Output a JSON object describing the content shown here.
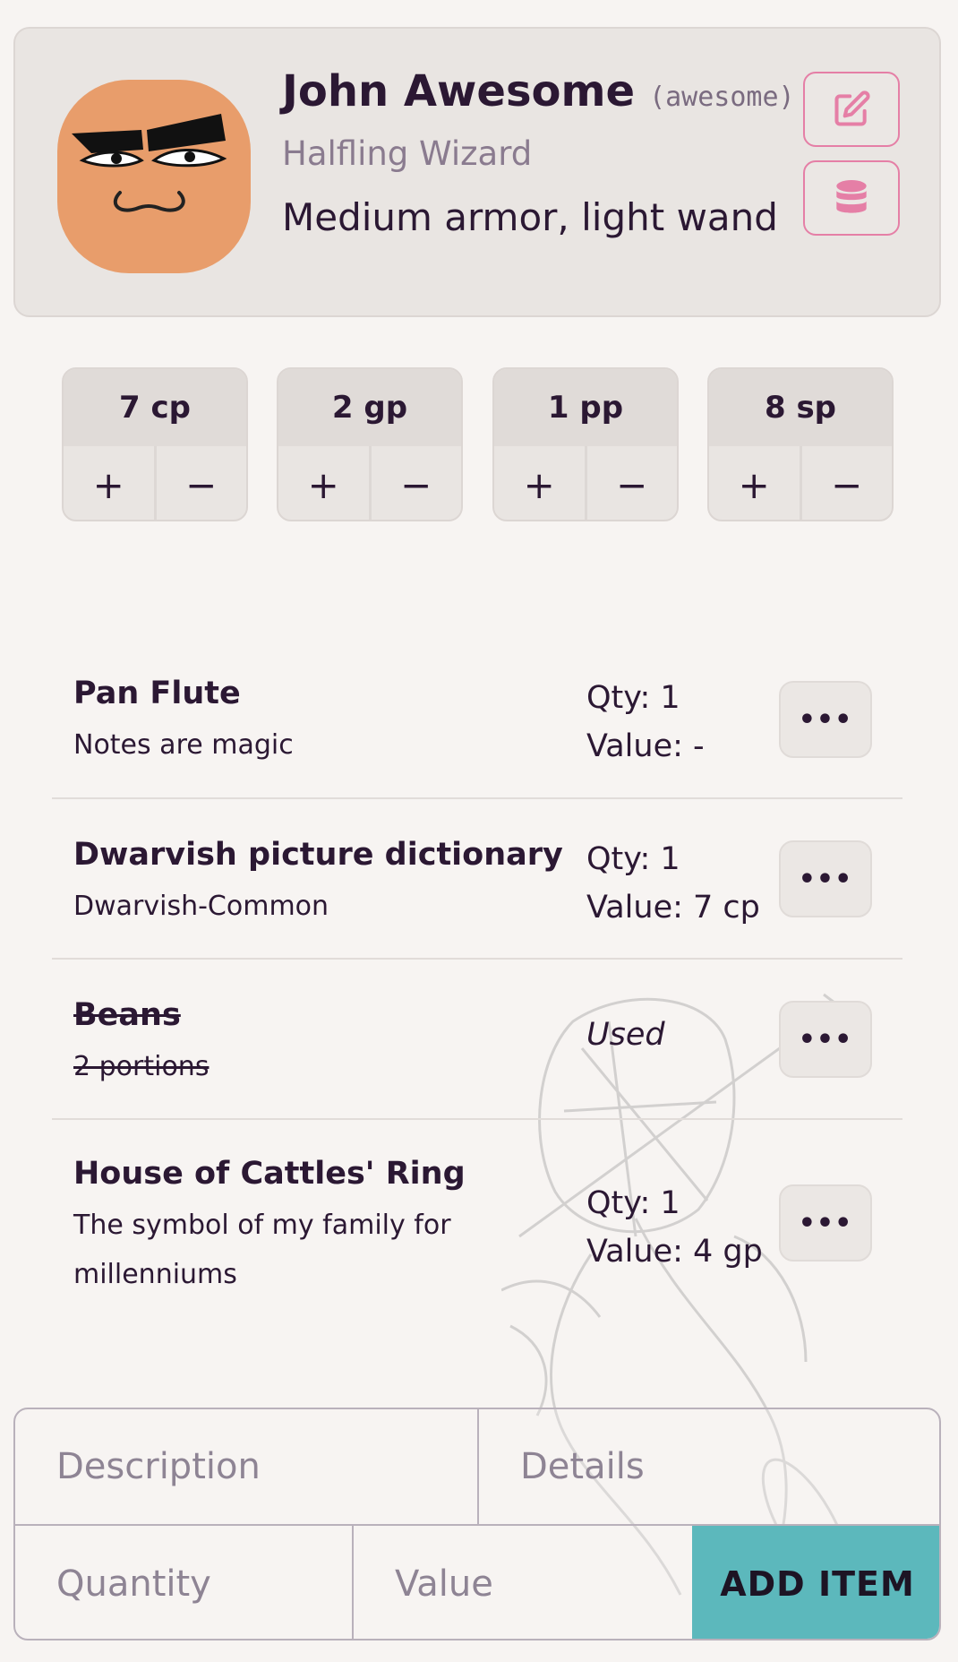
{
  "character": {
    "name": "John Awesome",
    "handle": "(awesome)",
    "class": "Halfling Wizard",
    "description": "Medium armor, light wand"
  },
  "icons": {
    "edit": "edit-icon",
    "database": "database-icon",
    "avatar": "avatar-face"
  },
  "coins": [
    {
      "label": "7 cp",
      "plus": "+",
      "minus": "−"
    },
    {
      "label": "2 gp",
      "plus": "+",
      "minus": "−"
    },
    {
      "label": "1 pp",
      "plus": "+",
      "minus": "−"
    },
    {
      "label": "8 sp",
      "plus": "+",
      "minus": "−"
    }
  ],
  "items": [
    {
      "name": "Pan Flute",
      "note": "Notes are magic",
      "qty": "Qty: 1",
      "value": "Value: -",
      "more": "•••"
    },
    {
      "name": "Dwarvish picture dictionary",
      "note": "Dwarvish-Common",
      "qty": "Qty: 1",
      "value": "Value: 7 cp",
      "more": "•••"
    },
    {
      "name": "Beans",
      "note": "2 portions",
      "status": "Used",
      "more": "•••"
    },
    {
      "name": "House of Cattles' Ring",
      "note": "The symbol of my family for millenniums",
      "qty": "Qty: 1",
      "value": "Value: 4 gp",
      "more": "•••"
    }
  ],
  "form": {
    "description_placeholder": "Description",
    "details_placeholder": "Details",
    "quantity_placeholder": "Quantity",
    "value_placeholder": "Value",
    "add_label": "ADD ITEM"
  },
  "colors": {
    "accent_pink": "#e57fa6",
    "add_button": "#5cb8bc",
    "avatar_skin": "#e89d6b"
  }
}
